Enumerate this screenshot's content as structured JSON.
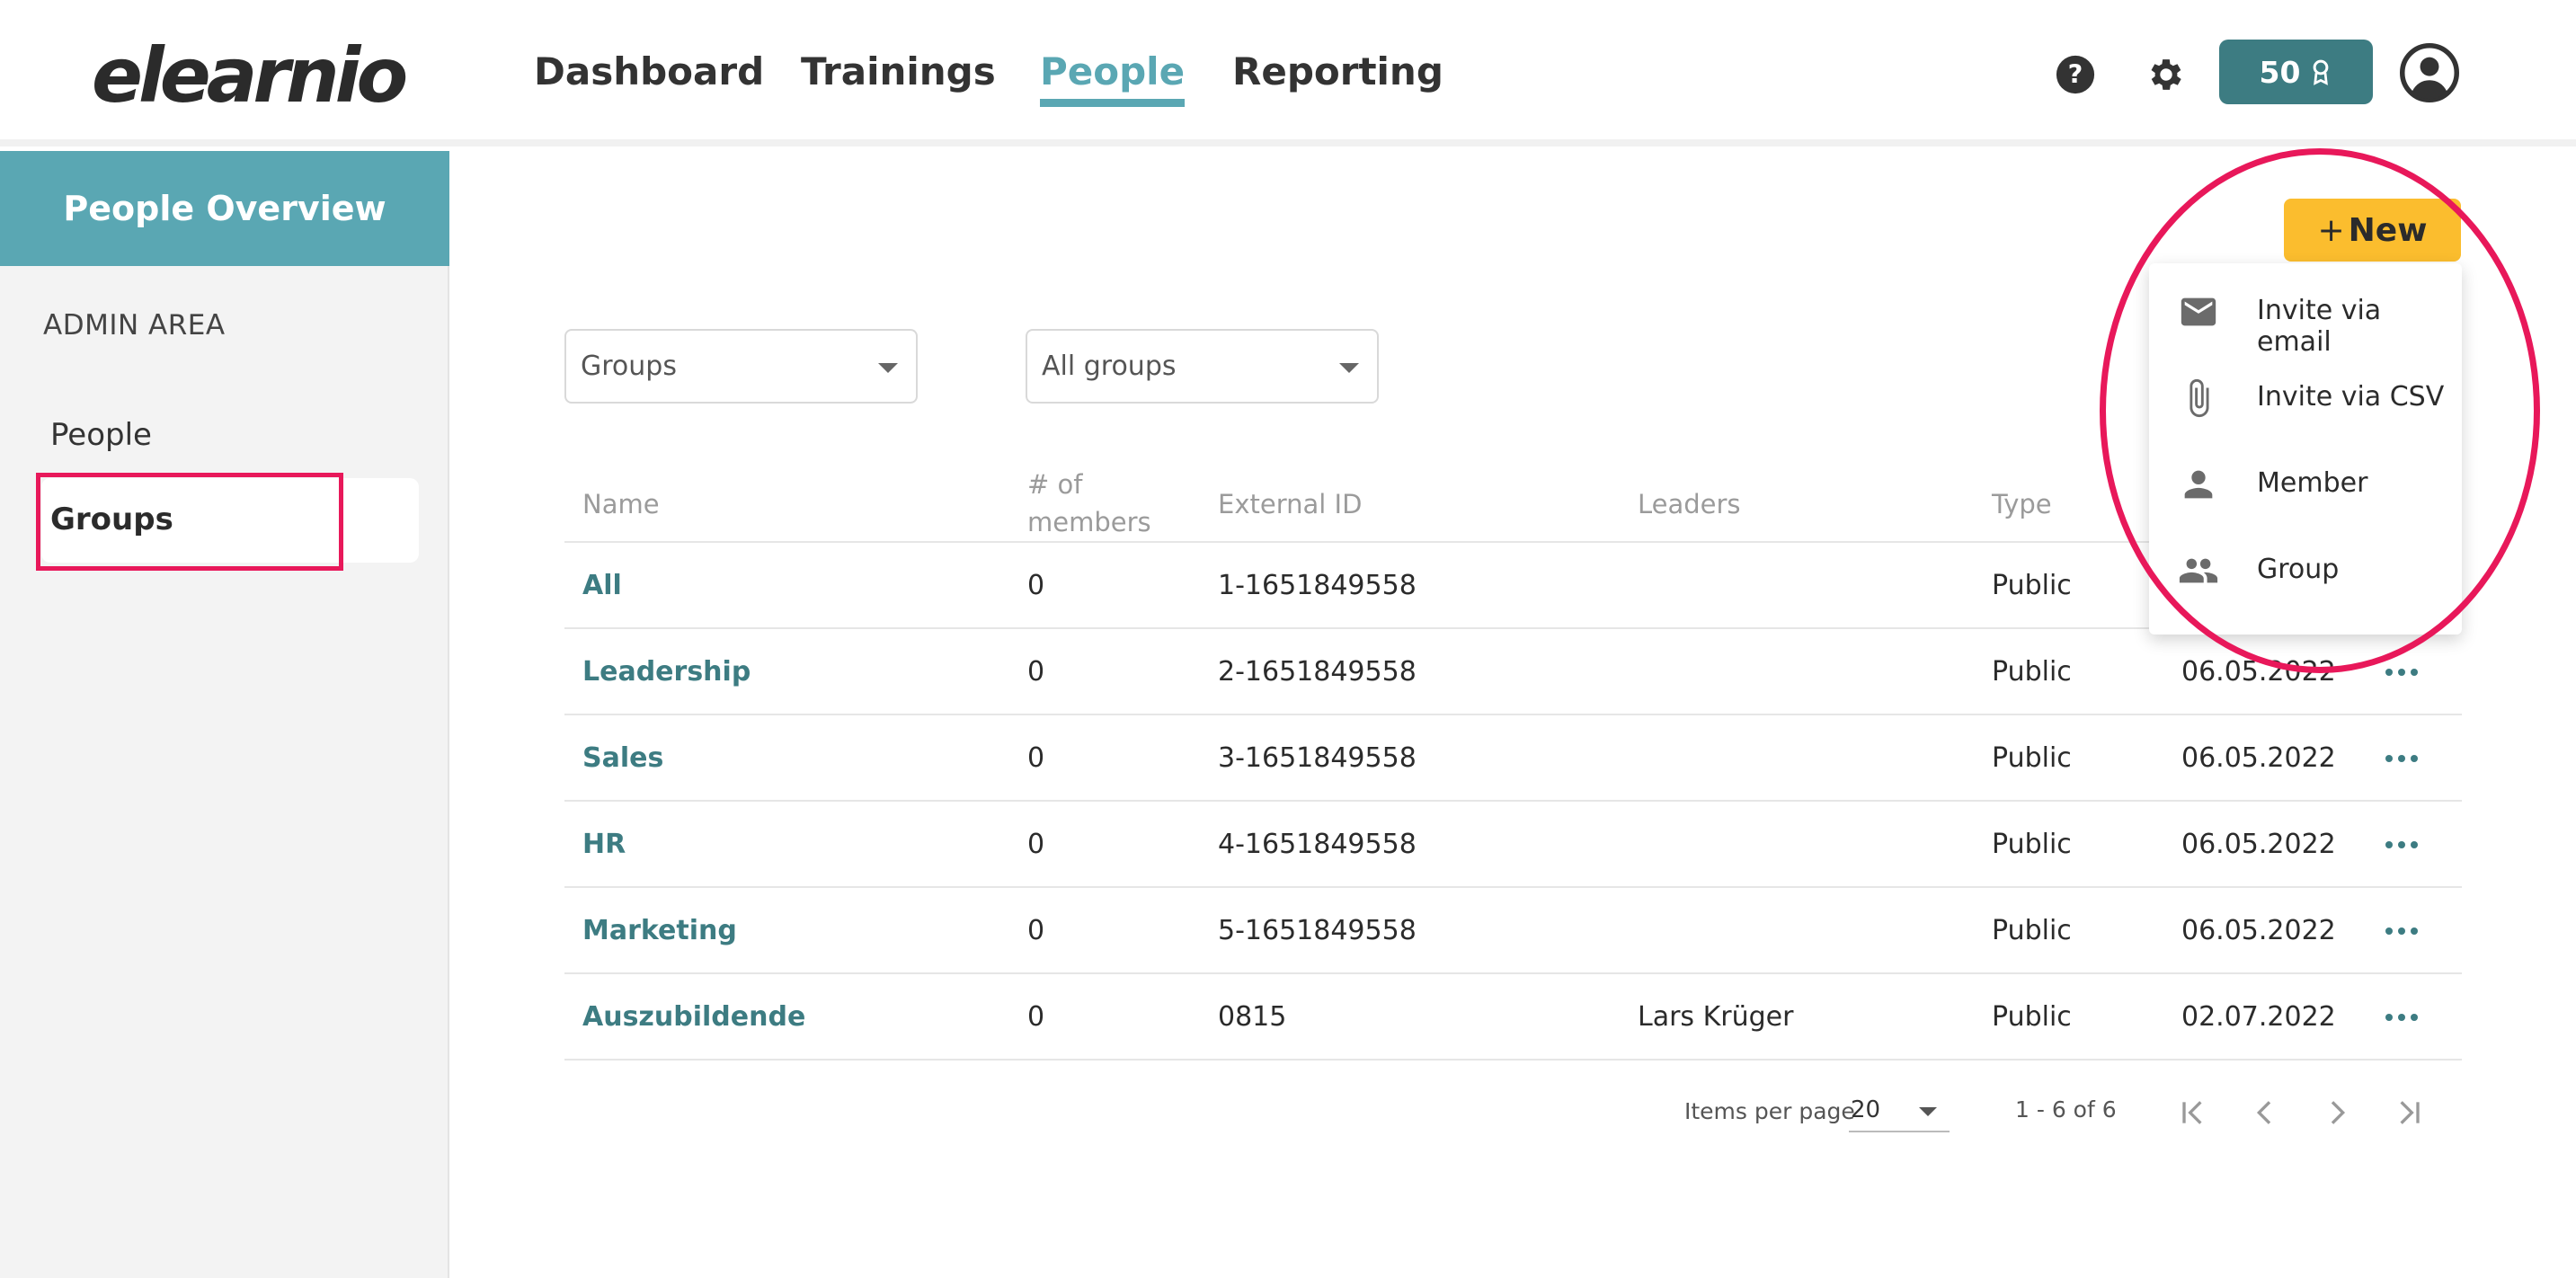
{
  "brand": {
    "logo_text": "elearnio",
    "accent": "#5aa7b3",
    "primary": "#3d7c82",
    "highlight": "#e8185a",
    "button_yellow": "#fbbd2e"
  },
  "nav": {
    "items": [
      "Dashboard",
      "Trainings",
      "People",
      "Reporting"
    ],
    "active": "People"
  },
  "header": {
    "credits_value": "50",
    "credits_icon": "award-icon",
    "help_icon": "help-circle-icon",
    "settings_icon": "gear-icon",
    "avatar_icon": "user-avatar-icon"
  },
  "sidebar": {
    "title": "People Overview",
    "section_label": "ADMIN AREA",
    "items": [
      "People",
      "Groups"
    ],
    "selected": "Groups"
  },
  "filters": {
    "type_select": "Groups",
    "scope_select": "All groups"
  },
  "table": {
    "columns": {
      "name": "Name",
      "members_line1": "# of",
      "members_line2": "members",
      "external_id": "External ID",
      "leaders": "Leaders",
      "type": "Type"
    },
    "rows": [
      {
        "name": "All",
        "members": "0",
        "external_id": "1-1651849558",
        "leaders": "",
        "type": "Public",
        "date": ""
      },
      {
        "name": "Leadership",
        "members": "0",
        "external_id": "2-1651849558",
        "leaders": "",
        "type": "Public",
        "date": "06.05.2022"
      },
      {
        "name": "Sales",
        "members": "0",
        "external_id": "3-1651849558",
        "leaders": "",
        "type": "Public",
        "date": "06.05.2022"
      },
      {
        "name": "HR",
        "members": "0",
        "external_id": "4-1651849558",
        "leaders": "",
        "type": "Public",
        "date": "06.05.2022"
      },
      {
        "name": "Marketing",
        "members": "0",
        "external_id": "5-1651849558",
        "leaders": "",
        "type": "Public",
        "date": "06.05.2022"
      },
      {
        "name": "Auszubildende",
        "members": "0",
        "external_id": "0815",
        "leaders": "Lars Krüger",
        "type": "Public",
        "date": "02.07.2022"
      }
    ]
  },
  "pagination": {
    "items_per_page_label": "Items per page",
    "items_per_page": "20",
    "range": "1 - 6 of 6"
  },
  "new_button": {
    "plus": "+",
    "label": "New"
  },
  "new_menu": {
    "items": [
      {
        "label": "Invite via email",
        "icon": "envelope-icon"
      },
      {
        "label": "Invite via CSV",
        "icon": "paperclip-icon"
      },
      {
        "label": "Member",
        "icon": "person-icon"
      },
      {
        "label": "Group",
        "icon": "people-group-icon"
      }
    ]
  }
}
